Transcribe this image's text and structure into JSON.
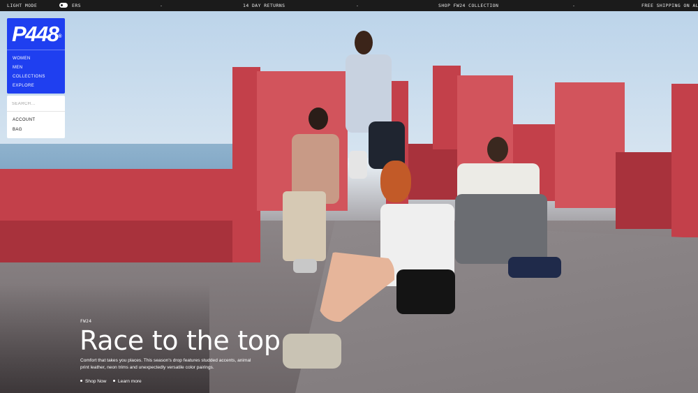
{
  "topbar": {
    "mode_label": "LIGHT MODE",
    "ticker_1": "ERS",
    "sep": "-",
    "ticker_2": "14 DAY RETURNS",
    "ticker_3": "SHOP FW24 COLLECTION",
    "ticker_4": "FREE SHIPPING ON ALL ORD"
  },
  "nav": {
    "logo": "P448",
    "logo_mark": "®",
    "items": [
      "WOMEN",
      "MEN",
      "COLLECTIONS",
      "EXPLORE"
    ]
  },
  "utility": {
    "search_placeholder": "SEARCH...",
    "account": "ACCOUNT",
    "bag": "BAG"
  },
  "hero": {
    "eyebrow": "FW24",
    "headline": "Race to the top",
    "description": "Comfort that takes you places. This season's drop features studded accents, animal print leather, neon trims and unexpectedly versatile color pairings.",
    "cta_primary": "Shop Now",
    "cta_secondary": "Learn more"
  },
  "colors": {
    "brand_blue": "#1f3ff0",
    "wall_red": "#c3404a",
    "topbar_bg": "#1b1b1b"
  },
  "icons": {
    "mode_toggle": "toggle-switch-icon",
    "cta_bullet": "bullet-dot-icon"
  }
}
